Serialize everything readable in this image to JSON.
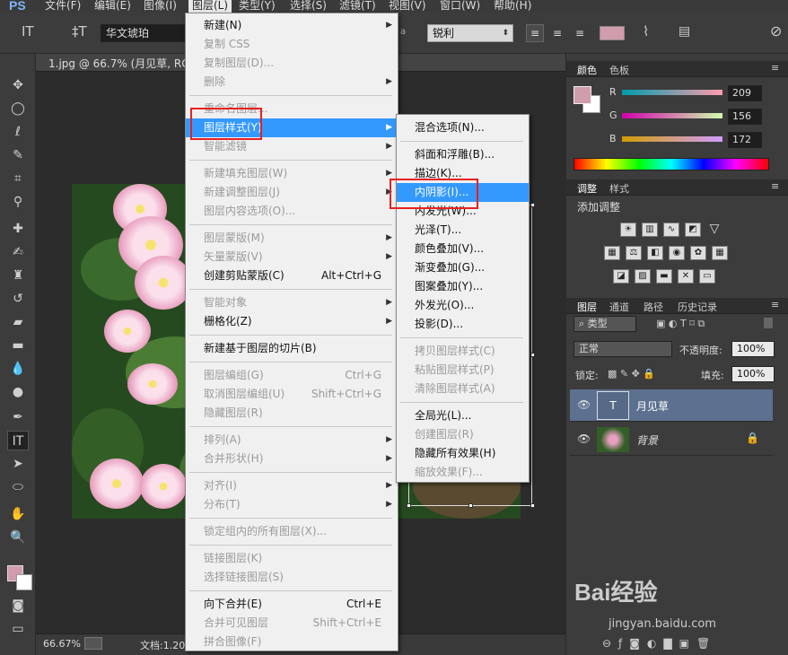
{
  "app": {
    "logo": "PS",
    "document_tab": "1.jpg @ 66.7% (月见草, RGB"
  },
  "menubar": [
    "文件(F)",
    "编辑(E)",
    "图像(I)",
    "图层(L)",
    "类型(Y)",
    "选择(S)",
    "滤镜(T)",
    "视图(V)",
    "窗口(W)",
    "帮助(H)"
  ],
  "options": {
    "font_family": "华文琥珀",
    "antialias_symbol": "a",
    "antialias": "锐利"
  },
  "layer_menu": [
    {
      "label": "新建(N)",
      "arrow": true
    },
    {
      "label": "复制 CSS",
      "disabled": true
    },
    {
      "label": "复制图层(D)...",
      "disabled": true
    },
    {
      "label": "删除",
      "disabled": true,
      "arrow": true
    },
    {
      "sep": true
    },
    {
      "label": "重命名图层...",
      "disabled": true
    },
    {
      "label": "图层样式(Y)",
      "arrow": true,
      "highlight": true
    },
    {
      "label": "智能滤镜",
      "disabled": true,
      "arrow": true
    },
    {
      "sep": true
    },
    {
      "label": "新建填充图层(W)",
      "disabled": true,
      "arrow": true
    },
    {
      "label": "新建调整图层(J)",
      "disabled": true,
      "arrow": true
    },
    {
      "label": "图层内容选项(O)...",
      "disabled": true
    },
    {
      "sep": true
    },
    {
      "label": "图层蒙版(M)",
      "disabled": true,
      "arrow": true
    },
    {
      "label": "矢量蒙版(V)",
      "disabled": true,
      "arrow": true
    },
    {
      "label": "创建剪贴蒙版(C)",
      "shortcut": "Alt+Ctrl+G"
    },
    {
      "sep": true
    },
    {
      "label": "智能对象",
      "disabled": true,
      "arrow": true
    },
    {
      "label": "栅格化(Z)",
      "arrow": true
    },
    {
      "sep": true
    },
    {
      "label": "新建基于图层的切片(B)"
    },
    {
      "sep": true
    },
    {
      "label": "图层编组(G)",
      "disabled": true,
      "shortcut": "Ctrl+G"
    },
    {
      "label": "取消图层编组(U)",
      "disabled": true,
      "shortcut": "Shift+Ctrl+G"
    },
    {
      "label": "隐藏图层(R)",
      "disabled": true
    },
    {
      "sep": true
    },
    {
      "label": "排列(A)",
      "disabled": true,
      "arrow": true
    },
    {
      "label": "合并形状(H)",
      "disabled": true,
      "arrow": true
    },
    {
      "sep": true
    },
    {
      "label": "对齐(I)",
      "disabled": true,
      "arrow": true
    },
    {
      "label": "分布(T)",
      "disabled": true,
      "arrow": true
    },
    {
      "sep": true
    },
    {
      "label": "锁定组内的所有图层(X)...",
      "disabled": true
    },
    {
      "sep": true
    },
    {
      "label": "链接图层(K)",
      "disabled": true
    },
    {
      "label": "选择链接图层(S)",
      "disabled": true
    },
    {
      "sep": true
    },
    {
      "label": "向下合并(E)",
      "shortcut": "Ctrl+E"
    },
    {
      "label": "合并可见图层",
      "disabled": true,
      "shortcut": "Shift+Ctrl+E"
    },
    {
      "label": "拼合图像(F)",
      "disabled": true
    }
  ],
  "style_submenu": [
    {
      "label": "混合选项(N)..."
    },
    {
      "sep": true
    },
    {
      "label": "斜面和浮雕(B)..."
    },
    {
      "label": "描边(K)..."
    },
    {
      "label": "内阴影(I)...",
      "highlight": true
    },
    {
      "label": "内发光(W)..."
    },
    {
      "label": "光泽(T)..."
    },
    {
      "label": "颜色叠加(V)..."
    },
    {
      "label": "渐变叠加(G)..."
    },
    {
      "label": "图案叠加(Y)..."
    },
    {
      "label": "外发光(O)..."
    },
    {
      "label": "投影(D)..."
    },
    {
      "sep": true
    },
    {
      "label": "拷贝图层样式(C)",
      "disabled": true
    },
    {
      "label": "粘贴图层样式(P)",
      "disabled": true
    },
    {
      "label": "清除图层样式(A)",
      "disabled": true
    },
    {
      "sep": true
    },
    {
      "label": "全局光(L)..."
    },
    {
      "label": "创建图层(R)",
      "disabled": true
    },
    {
      "label": "隐藏所有效果(H)"
    },
    {
      "label": "缩放效果(F)...",
      "disabled": true
    }
  ],
  "color_panel": {
    "tabs": [
      "颜色",
      "色板"
    ],
    "channels": [
      {
        "name": "R",
        "value": "209"
      },
      {
        "name": "G",
        "value": "156"
      },
      {
        "name": "B",
        "value": "172"
      }
    ],
    "foreground": "#d19cac"
  },
  "adjust_panel": {
    "tabs": [
      "调整",
      "样式"
    ],
    "title": "添加调整"
  },
  "layers_panel": {
    "tabs": [
      "图层",
      "通道",
      "路径",
      "历史记录"
    ],
    "filter": "类型",
    "blend": "正常",
    "opacity_label": "不透明度:",
    "opacity": "100%",
    "lock_label": "锁定:",
    "fill_label": "填充:",
    "fill": "100%",
    "layers": [
      {
        "name": "月见草",
        "selected": true,
        "type": "text"
      },
      {
        "name": "背景",
        "selected": false,
        "type": "image",
        "locked": true
      }
    ]
  },
  "status": {
    "zoom": "66.67%",
    "doc": "文档:1.20"
  },
  "watermark": {
    "brand": "Bai经验",
    "url": "jingyan.baidu.com"
  }
}
